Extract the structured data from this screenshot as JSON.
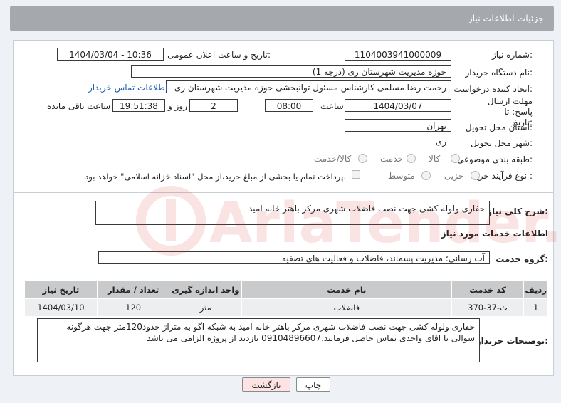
{
  "header": {
    "title": "جزئیات اطلاعات نیاز"
  },
  "form": {
    "need_number_label": "شماره نیاز:",
    "need_number": "1104003941000009",
    "announce_label": "تاریخ و ساعت اعلان عمومی:",
    "announce_value": "1404/03/04 - 10:36",
    "buyer_label": "نام دستگاه خریدار:",
    "buyer_value": "حوزه مدیریت   شهرستان ری (درجه 1)",
    "creator_label": "ایجاد کننده درخواست:",
    "creator_value": "رحمت رضا مسلمی کارشناس مسئول توانبخشی حوزه مدیریت   شهرستان ری",
    "contact_link": "اطلاعات تماس خریدار",
    "deadline_label": "مهلت ارسال پاسخ: تا تاریخ:",
    "deadline_date": "1404/03/07",
    "time_label": "ساعت",
    "deadline_time": "08:00",
    "days_value": "2",
    "days_label": "روز و",
    "remaining_time": "19:51:38",
    "remaining_label": "ساعت باقی مانده",
    "province_label": "استان محل تحویل:",
    "province_value": "تهران",
    "city_label": "شهر محل تحویل:",
    "city_value": "ری",
    "category_label": "طبقه بندی موضوعی:",
    "category_options": [
      "کالا",
      "خدمت",
      "کالا/خدمت"
    ],
    "process_label": "نوع فرآیند خرید :",
    "process_options": [
      "جزیی",
      "متوسط"
    ],
    "payment_note": "پرداخت تمام یا بخشی از مبلغ خرید،از محل \"اسناد خزانه اسلامی\" خواهد بود."
  },
  "summary": {
    "label": "شرح کلی نیاز:",
    "value": "حفاری ولوله کشی جهت نصب فاضلاب شهری مرکز باهتر خانه امید"
  },
  "services": {
    "section_title": "اطلاعات خدمات مورد نیاز",
    "group_label": "گروه خدمت:",
    "group_value": "آب رسانی؛ مدیریت پسماند، فاضلاب و فعالیت های تصفیه",
    "columns": [
      "ردیف",
      "کد خدمت",
      "نام خدمت",
      "واحد اندازه گیری",
      "تعداد / مقدار",
      "تاریخ نیاز"
    ],
    "rows": [
      [
        "1",
        "ث-37-370",
        "فاضلاب",
        "متر",
        "120",
        "1404/03/10"
      ]
    ]
  },
  "buyer_notes": {
    "label": "توضیحات خریدار:",
    "value": "حفاری ولوله کشی جهت نصب فاضلاب شهری مرکز باهتر خانه امید به شبکه اگو به متراژ حدود120متر جهت هرگونه سوالی با اقای واحدی تماس حاصل فرمایید.09104896607 بازدید از پروژه الزامی می باشد"
  },
  "buttons": {
    "print": "چاپ",
    "back": "بازگشت"
  },
  "watermark": {
    "text": "AriaTender.net"
  },
  "colors": {
    "header_bg": "#a5a9ad",
    "back_button_bg": "#fde3e3",
    "link": "#1a5fb4",
    "watermark": "#d32f2f"
  }
}
